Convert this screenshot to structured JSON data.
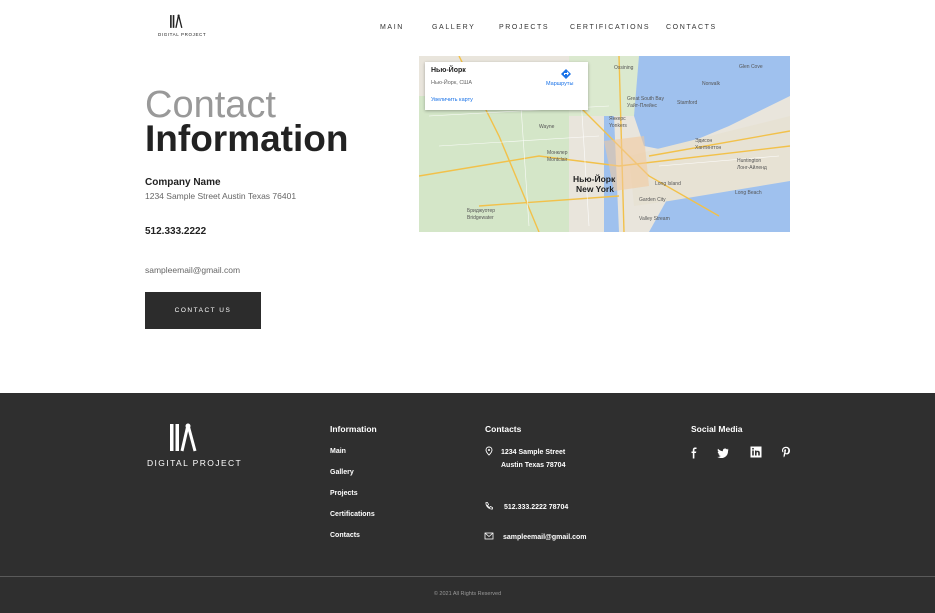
{
  "header": {
    "logo_text": "DIGITAL PROJECT",
    "nav": [
      "MAIN",
      "GALLERY",
      "PROJECTS",
      "CERTIFICATIONS",
      "CONTACTS"
    ]
  },
  "contact": {
    "title_light": "Contact",
    "title_bold": "Information",
    "company": "Company Name",
    "address": "1234 Sample Street Austin Texas 76401",
    "phone": "512.333.2222",
    "email": "sampleemail@gmail.com",
    "button": "CONTACT US"
  },
  "map": {
    "place": "Нью-Йорк",
    "subtitle": "Нью-Йорк, США",
    "zoom_link": "Увеличить карту",
    "directions": "Маршруты",
    "city_label": "Нью-Йорк",
    "city_label_en": "New York",
    "labels": [
      "Ossining",
      "Glen Cove",
      "Norwalk",
      "Stamford",
      "Янкерс",
      "Yonkers",
      "Nью-Рошелл",
      "New Rochelle",
      "Монклер",
      "Montclair",
      "Уэйн",
      "Wayne",
      "Бриджуотер",
      "Bridgewater",
      "Эдисон",
      "Хантингтон",
      "Huntington",
      "Лонг-Айленд",
      "Long Island",
      "Garden City",
      "Valley Stream",
      "Long Beach",
      "Great South Bay",
      "Уайт-Плейнс",
      "White Plains",
      "Стамфорд",
      "Нью-Йорк"
    ]
  },
  "footer": {
    "logo_text": "DIGITAL PROJECT",
    "information_title": "Information",
    "information_links": [
      "Main",
      "Gallery",
      "Projects",
      "Certifications",
      "Contacts"
    ],
    "contacts_title": "Contacts",
    "address_line1": "1234 Sample Street",
    "address_line2": "Austin Texas 78704",
    "phone": "512.333.2222 78704",
    "email": "sampleemail@gmail.com",
    "social_title": "Social Media",
    "social_icons": [
      "facebook-icon",
      "twitter-icon",
      "linkedin-icon",
      "pinterest-icon"
    ],
    "copyright": "© 2021 All Rights Reserved"
  },
  "colors": {
    "footer_bg": "#2f2f2f",
    "button_bg": "#2c2c2c",
    "link_blue": "#1a73e8"
  }
}
